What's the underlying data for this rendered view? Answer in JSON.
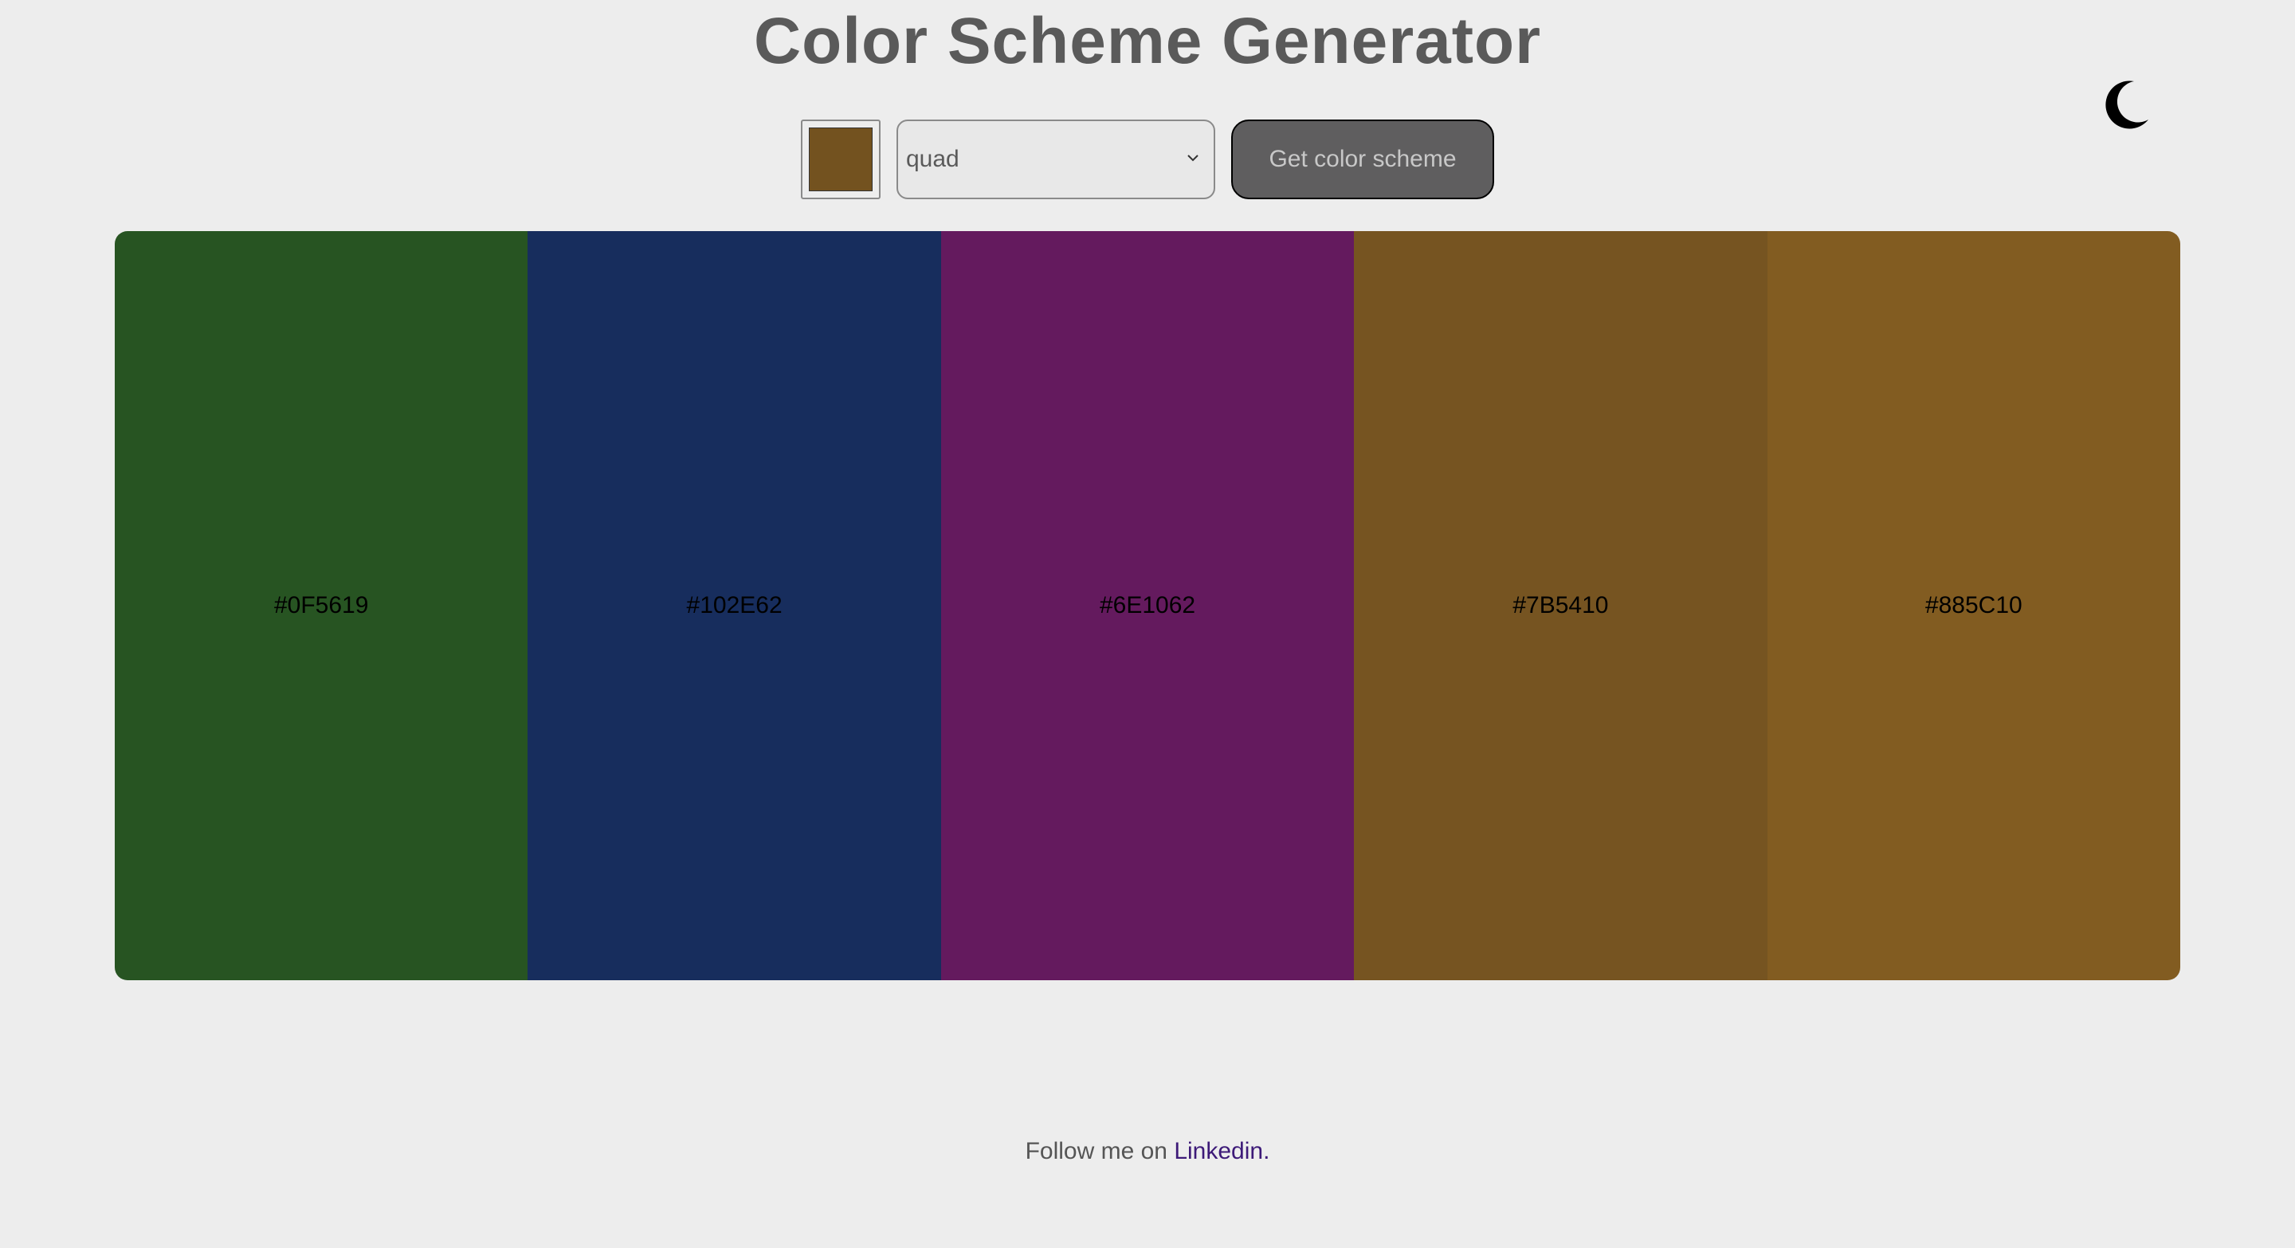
{
  "header": {
    "title": "Color Scheme Generator",
    "theme_icon": "moon-icon"
  },
  "controls": {
    "seed_color": "#73521F",
    "mode_value": "quad",
    "button_label": "Get color scheme"
  },
  "palette": [
    {
      "hex": "#0F5619",
      "color": "#275422"
    },
    {
      "hex": "#102E62",
      "color": "#172d5d"
    },
    {
      "hex": "#6E1062",
      "color": "#641a5e"
    },
    {
      "hex": "#7B5410",
      "color": "#765421"
    },
    {
      "hex": "#885C10",
      "color": "#825c21"
    }
  ],
  "footer": {
    "text": "Follow me on ",
    "link_label": "Linkedin."
  },
  "colors": {
    "background": "#ededed",
    "title": "#5a5a5a",
    "button_bg": "#5f5e5f",
    "link": "#3d1a78"
  }
}
